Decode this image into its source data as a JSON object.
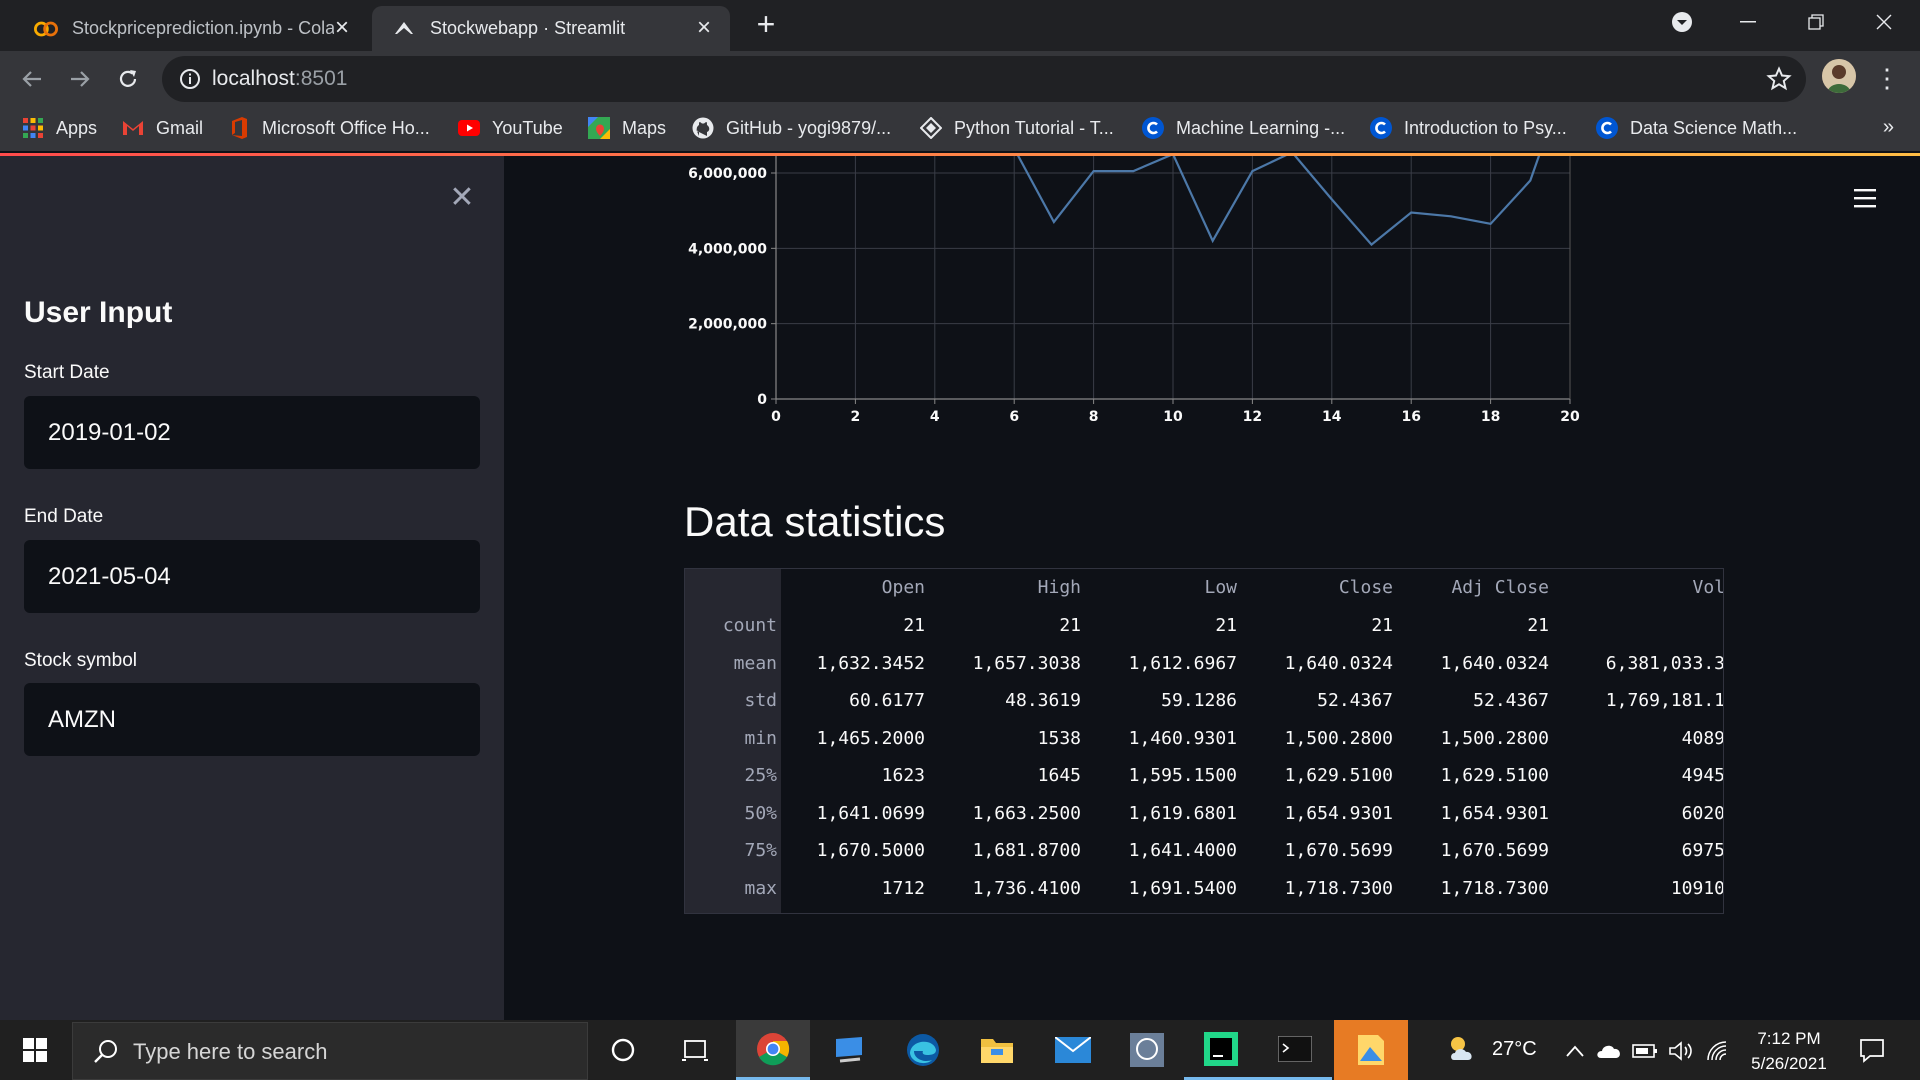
{
  "browser": {
    "tabs": [
      {
        "title": "Stockpriceprediction.ipynb - Cola",
        "active": false,
        "icon": "colab-icon"
      },
      {
        "title": "Stockwebapp · Streamlit",
        "active": true,
        "icon": "streamlit-icon"
      }
    ],
    "url_host": "localhost",
    "url_port": ":8501",
    "bookmarks": [
      {
        "label": "Apps",
        "icon": "apps-grid-icon"
      },
      {
        "label": "Gmail",
        "icon": "gmail-icon"
      },
      {
        "label": "Microsoft Office Ho...",
        "icon": "office-icon"
      },
      {
        "label": "YouTube",
        "icon": "youtube-icon"
      },
      {
        "label": "Maps",
        "icon": "maps-icon"
      },
      {
        "label": "GitHub - yogi9879/...",
        "icon": "github-icon"
      },
      {
        "label": "Python Tutorial - T...",
        "icon": "tutorial-icon"
      },
      {
        "label": "Machine Learning -...",
        "icon": "coursera-icon"
      },
      {
        "label": "Introduction to Psy...",
        "icon": "coursera-icon"
      },
      {
        "label": "Data Science Math...",
        "icon": "coursera-icon"
      }
    ],
    "bookmarks_more": "»"
  },
  "sidebar": {
    "heading": "User Input",
    "start_date_label": "Start Date",
    "start_date_value": "2019-01-02",
    "end_date_label": "End Date",
    "end_date_value": "2021-05-04",
    "symbol_label": "Stock symbol",
    "symbol_value": "AMZN"
  },
  "main": {
    "stats_heading": "Data statistics",
    "stats": {
      "columns": [
        "Open",
        "High",
        "Low",
        "Close",
        "Adj Close",
        "Vol"
      ],
      "rows": [
        {
          "name": "count",
          "values": [
            "21",
            "21",
            "21",
            "21",
            "21",
            ""
          ]
        },
        {
          "name": "mean",
          "values": [
            "1,632.3452",
            "1,657.3038",
            "1,612.6967",
            "1,640.0324",
            "1,640.0324",
            "6,381,033.3"
          ]
        },
        {
          "name": "std",
          "values": [
            "60.6177",
            "48.3619",
            "59.1286",
            "52.4367",
            "52.4367",
            "1,769,181.1"
          ]
        },
        {
          "name": "min",
          "values": [
            "1,465.2000",
            "1538",
            "1,460.9301",
            "1,500.2800",
            "1,500.2800",
            "4089"
          ]
        },
        {
          "name": "25%",
          "values": [
            "1623",
            "1645",
            "1,595.1500",
            "1,629.5100",
            "1,629.5100",
            "4945"
          ]
        },
        {
          "name": "50%",
          "values": [
            "1,641.0699",
            "1,663.2500",
            "1,619.6801",
            "1,654.9301",
            "1,654.9301",
            "6020"
          ]
        },
        {
          "name": "75%",
          "values": [
            "1,670.5000",
            "1,681.8700",
            "1,641.4000",
            "1,670.5699",
            "1,670.5699",
            "6975"
          ]
        },
        {
          "name": "max",
          "values": [
            "1712",
            "1,736.4100",
            "1,691.5400",
            "1,718.7300",
            "1,718.7300",
            "10910"
          ]
        }
      ]
    }
  },
  "chart_data": {
    "type": "line",
    "x": [
      5,
      6,
      7,
      8,
      9,
      10,
      11,
      12,
      13,
      14,
      15,
      16,
      17,
      18,
      19,
      19.3
    ],
    "y": [
      6500000,
      6650000,
      4700000,
      6050000,
      6050000,
      6500000,
      4200000,
      6050000,
      6550000,
      5300000,
      4100000,
      4950000,
      4850000,
      4650000,
      5800000,
      6700000
    ],
    "xticks": [
      "0",
      "2",
      "4",
      "6",
      "8",
      "10",
      "12",
      "14",
      "16",
      "18",
      "20"
    ],
    "yticks": [
      "0",
      "2,000,000",
      "4,000,000",
      "6,000,000"
    ],
    "xlim": [
      0,
      20
    ],
    "ylim": [
      0,
      6400000
    ],
    "grid": true,
    "line_color": "#4c78a8"
  },
  "taskbar": {
    "search_placeholder": "Type here to search",
    "weather": "27°C",
    "time": "7:12 PM",
    "date": "5/26/2021"
  }
}
